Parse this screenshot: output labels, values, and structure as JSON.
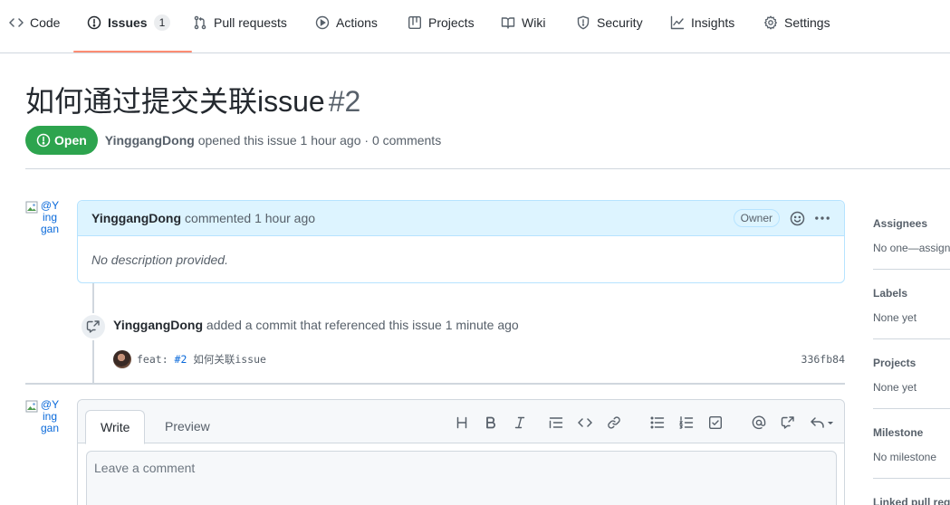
{
  "nav": {
    "tabs": [
      {
        "label": "Code",
        "icon": "code-icon"
      },
      {
        "label": "Issues",
        "icon": "issue-opened-icon",
        "count": "1"
      },
      {
        "label": "Pull requests",
        "icon": "git-pull-request-icon"
      },
      {
        "label": "Actions",
        "icon": "play-icon"
      },
      {
        "label": "Projects",
        "icon": "table-icon"
      },
      {
        "label": "Wiki",
        "icon": "book-icon"
      },
      {
        "label": "Security",
        "icon": "shield-icon"
      },
      {
        "label": "Insights",
        "icon": "graph-icon"
      },
      {
        "label": "Settings",
        "icon": "gear-icon"
      }
    ],
    "selected": "Issues",
    "accent_color": "#fd8c73"
  },
  "issue": {
    "title": "如何通过提交关联issue",
    "number": "#2",
    "state": "Open",
    "state_color": "#2da44e",
    "author": "YinggangDong",
    "opened_text": "opened this issue 1 hour ago · 0 comments"
  },
  "comment": {
    "avatar_alt": "@YinggangDong",
    "author": "YinggangDong",
    "action": "commented 1 hour ago",
    "role": "Owner",
    "body": "No description provided."
  },
  "timeline_event": {
    "author": "YinggangDong",
    "text": "added a commit that referenced this issue 1 minute ago",
    "commit_prefix": "feat: ",
    "commit_ref": "#2",
    "commit_suffix": " 如何关联issue",
    "sha": "336fb84"
  },
  "editor": {
    "avatar_alt": "@YinggangDong",
    "tab_write": "Write",
    "tab_preview": "Preview",
    "placeholder": "Leave a comment"
  },
  "sidebar": [
    {
      "title": "Assignees",
      "value": "No one—assign yourself"
    },
    {
      "title": "Labels",
      "value": "None yet"
    },
    {
      "title": "Projects",
      "value": "None yet"
    },
    {
      "title": "Milestone",
      "value": "No milestone"
    },
    {
      "title": "Linked pull requests",
      "value": ""
    }
  ]
}
